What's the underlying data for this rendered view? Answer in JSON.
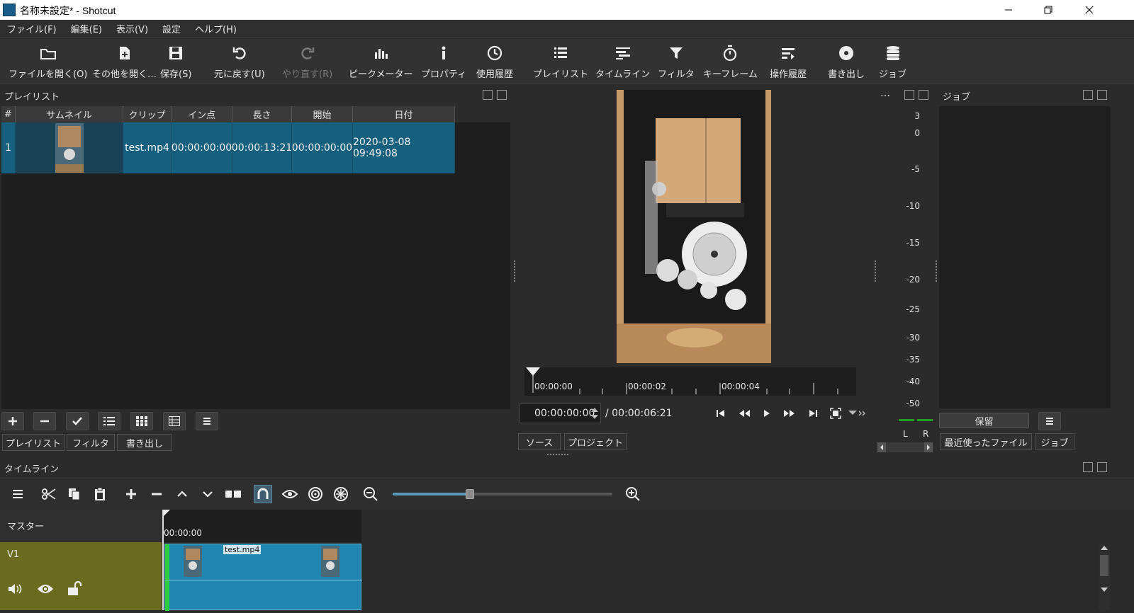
{
  "window": {
    "title": "名称未設定* - Shotcut"
  },
  "menu": [
    "ファイル(F)",
    "編集(E)",
    "表示(V)",
    "設定",
    "ヘルプ(H)"
  ],
  "toolbar": {
    "open": "ファイルを開く(O)",
    "open_other": "その他を開く…",
    "save": "保存(S)",
    "undo": "元に戻す(U)",
    "redo": "やり直す(R)",
    "peak_meter": "ピークメーター",
    "properties": "プロパティ",
    "recent": "使用履歴",
    "playlist": "プレイリスト",
    "timeline": "タイムライン",
    "filter": "フィルタ",
    "keyframe": "キーフレーム",
    "history": "操作履歴",
    "export": "書き出し",
    "jobs": "ジョブ"
  },
  "playlist": {
    "title": "プレイリスト",
    "columns": [
      "#",
      "サムネイル",
      "クリップ",
      "イン点",
      "長さ",
      "開始",
      "日付"
    ],
    "rows": [
      {
        "num": "1",
        "clip": "test.mp4",
        "in": "00:00:00:00",
        "duration": "00:00:13:21",
        "start": "00:00:00:00",
        "date": "2020-03-08 09:49:08"
      }
    ],
    "tabs": [
      "プレイリスト",
      "フィルタ",
      "書き出し"
    ]
  },
  "viewer": {
    "ruler_ticks": [
      "00:00:00",
      "00:00:02",
      "00:00:04"
    ],
    "timecode": "00:00:00:00",
    "duration": "/ 00:00:06:21",
    "tabs": [
      "ソース",
      "プロジェクト"
    ]
  },
  "meter": {
    "ticks": [
      "3",
      "0",
      "-5",
      "-10",
      "-15",
      "-20",
      "-25",
      "-30",
      "-35",
      "-40",
      "-50"
    ],
    "ellipsis": "…",
    "l_label": "L",
    "r_label": "R"
  },
  "jobs": {
    "title": "ジョブ",
    "hold_button": "保留",
    "tabs": [
      "最近使ったファイル",
      "ジョブ"
    ]
  },
  "timeline": {
    "title": "タイムライン",
    "master_label": "マスター",
    "track_label": "V1",
    "ruler_time": "00:00:00",
    "clip_name": "test.mp4",
    "zoom_level": 0.35
  },
  "colors": {
    "accent": "#15607f",
    "clip": "#1e86b0",
    "track": "#6b6b20"
  }
}
